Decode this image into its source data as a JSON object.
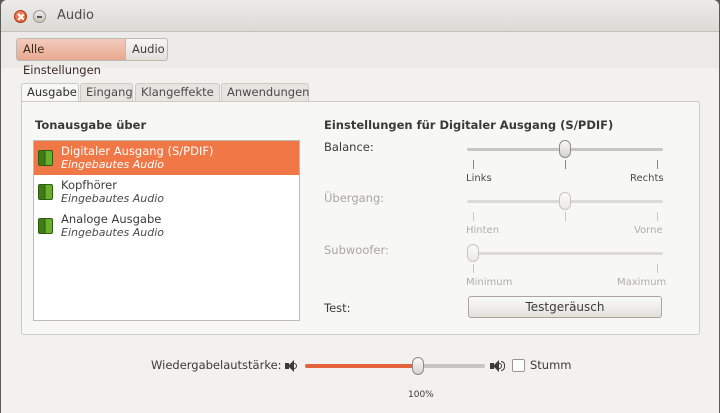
{
  "window": {
    "title": "Audio"
  },
  "toolbar": {
    "all_settings": "Alle Einstellungen",
    "current": "Audio"
  },
  "tabs": [
    {
      "label": "Ausgabe",
      "active": true
    },
    {
      "label": "Eingang",
      "active": false
    },
    {
      "label": "Klangeffekte",
      "active": false
    },
    {
      "label": "Anwendungen",
      "active": false
    }
  ],
  "output": {
    "heading": "Tonausgabe über",
    "devices": [
      {
        "name": "Digitaler Ausgang (S/PDIF)",
        "sub": "Eingebautes Audio",
        "selected": true,
        "icon": "audio-card-icon"
      },
      {
        "name": "Kopfhörer",
        "sub": "Eingebautes Audio",
        "selected": false,
        "icon": "audio-card-icon"
      },
      {
        "name": "Analoge Ausgabe",
        "sub": "Eingebautes Audio",
        "selected": false,
        "icon": "audio-card-icon"
      }
    ]
  },
  "settings": {
    "heading": "Einstellungen für Digitaler Ausgang (S/PDIF)",
    "balance": {
      "label": "Balance:",
      "left": "Links",
      "right": "Rechts",
      "value": 0.5,
      "enabled": true
    },
    "fade": {
      "label": "Übergang:",
      "left": "Hinten",
      "right": "Vorne",
      "value": 0.5,
      "enabled": false
    },
    "subwoofer": {
      "label": "Subwoofer:",
      "left": "Minimum",
      "right": "Maximum",
      "value": 0.0,
      "enabled": false
    },
    "test": {
      "label": "Test:",
      "button": "Testgeräusch"
    }
  },
  "volume": {
    "label": "Wiedergabelautstärke:",
    "value_percent": 100,
    "fill_fraction": 0.63,
    "percent_label": "100%",
    "mute_label": "Stumm",
    "muted": false
  },
  "colors": {
    "accent": "#f07746",
    "volume_fill": "#e4633a"
  }
}
